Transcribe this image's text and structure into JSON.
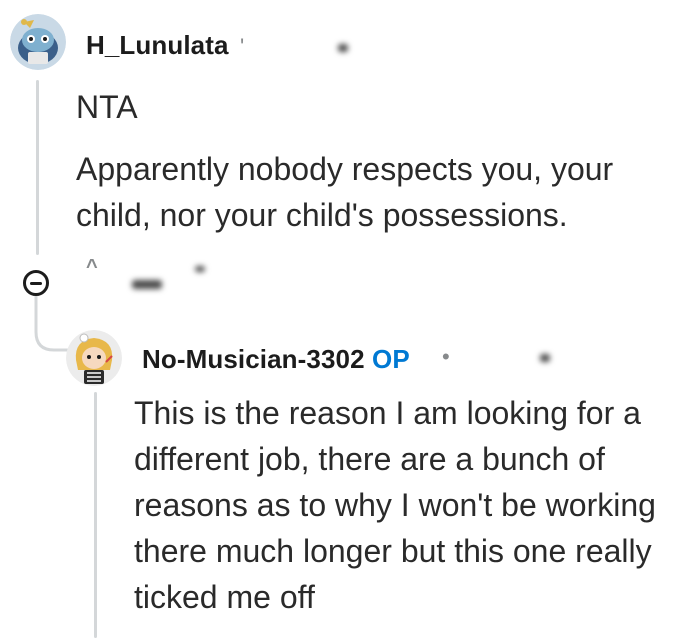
{
  "comments": [
    {
      "username": "H_Lunulata",
      "avatar_icon": "snoo-avatar-icon",
      "paragraphs": [
        "NTA",
        "Apparently nobody respects you, your child, nor your child's possessions."
      ]
    },
    {
      "username": "No-Musician-3302",
      "badge": "OP",
      "meta_dot": "•",
      "avatar_icon": "snoo-avatar-icon",
      "paragraphs": [
        "This is the reason I am looking for a different job, there are a bunch of reasons as to why I won't be working there much longer but this one really ticked me off"
      ]
    }
  ],
  "icons": {
    "collapse": "collapse-thread-icon",
    "upvote": "upvote-arrow-icon"
  }
}
